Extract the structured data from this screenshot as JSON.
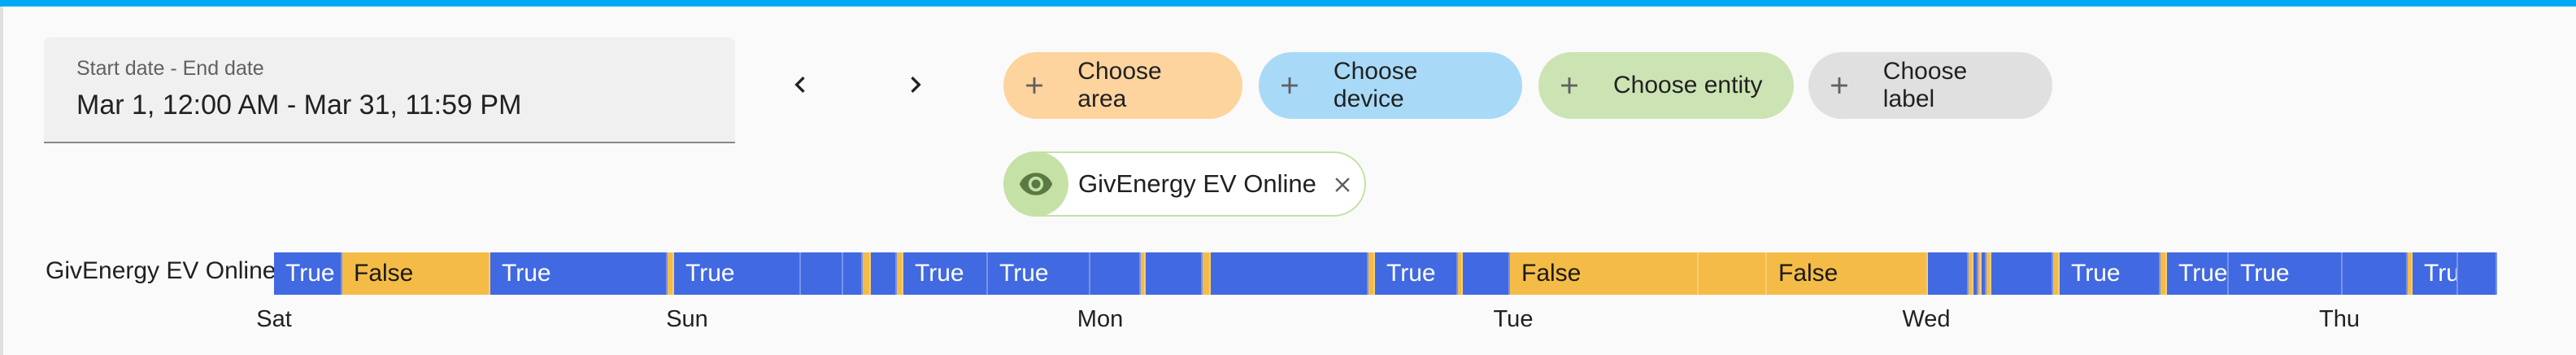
{
  "date_range": {
    "label": "Start date - End date",
    "value": "Mar 1, 12:00 AM - Mar 31, 11:59 PM"
  },
  "nav": {
    "prev_icon": "chevron-left-icon",
    "next_icon": "chevron-right-icon"
  },
  "target_pickers": [
    {
      "label": "Choose area",
      "color": "#fdd49e",
      "icon": "plus-icon"
    },
    {
      "label": "Choose device",
      "color": "#a8daf7",
      "icon": "plus-icon"
    },
    {
      "label": "Choose entity",
      "color": "#cce4b4",
      "icon": "plus-icon"
    },
    {
      "label": "Choose label",
      "color": "#e0e0e0",
      "icon": "plus-icon"
    }
  ],
  "selected_entity": {
    "label": "GivEnergy EV Online",
    "icon": "eye-icon",
    "remove_icon": "close-icon"
  },
  "timeline": {
    "entity_name": "GivEnergy EV Online",
    "colors": {
      "True": "#4169e1",
      "False": "#f4bc47"
    },
    "segments": [
      {
        "state": "True",
        "text": "True"
      },
      {
        "state": "False",
        "text": "False"
      },
      {
        "state": "True",
        "text": "True"
      },
      {
        "state": "False",
        "text": ""
      },
      {
        "state": "True",
        "text": "True"
      },
      {
        "state": "True",
        "text": ""
      },
      {
        "state": "True",
        "text": ""
      },
      {
        "state": "False",
        "text": ""
      },
      {
        "state": "True",
        "text": ""
      },
      {
        "state": "False",
        "text": ""
      },
      {
        "state": "True",
        "text": "True"
      },
      {
        "state": "True",
        "text": "True"
      },
      {
        "state": "True",
        "text": ""
      },
      {
        "state": "False",
        "text": ""
      },
      {
        "state": "True",
        "text": ""
      },
      {
        "state": "False",
        "text": ""
      },
      {
        "state": "True",
        "text": ""
      },
      {
        "state": "False",
        "text": ""
      },
      {
        "state": "True",
        "text": "True"
      },
      {
        "state": "False",
        "text": ""
      },
      {
        "state": "True",
        "text": ""
      },
      {
        "state": "False",
        "text": "False"
      },
      {
        "state": "False",
        "text": ""
      },
      {
        "state": "False",
        "text": "False"
      },
      {
        "state": "True",
        "text": ""
      },
      {
        "state": "False",
        "text": ""
      },
      {
        "state": "True",
        "text": ""
      },
      {
        "state": "False",
        "text": ""
      },
      {
        "state": "True",
        "text": ""
      },
      {
        "state": "False",
        "text": ""
      },
      {
        "state": "True",
        "text": ""
      },
      {
        "state": "False",
        "text": ""
      },
      {
        "state": "True",
        "text": "True"
      },
      {
        "state": "False",
        "text": ""
      },
      {
        "state": "True",
        "text": "True"
      },
      {
        "state": "True",
        "text": "True"
      },
      {
        "state": "True",
        "text": ""
      },
      {
        "state": "False",
        "text": ""
      },
      {
        "state": "True",
        "text": "True"
      },
      {
        "state": "True",
        "text": ""
      }
    ],
    "day_labels": [
      "Sat",
      "Sun",
      "Mon",
      "Tue",
      "Wed",
      "Thu"
    ]
  }
}
